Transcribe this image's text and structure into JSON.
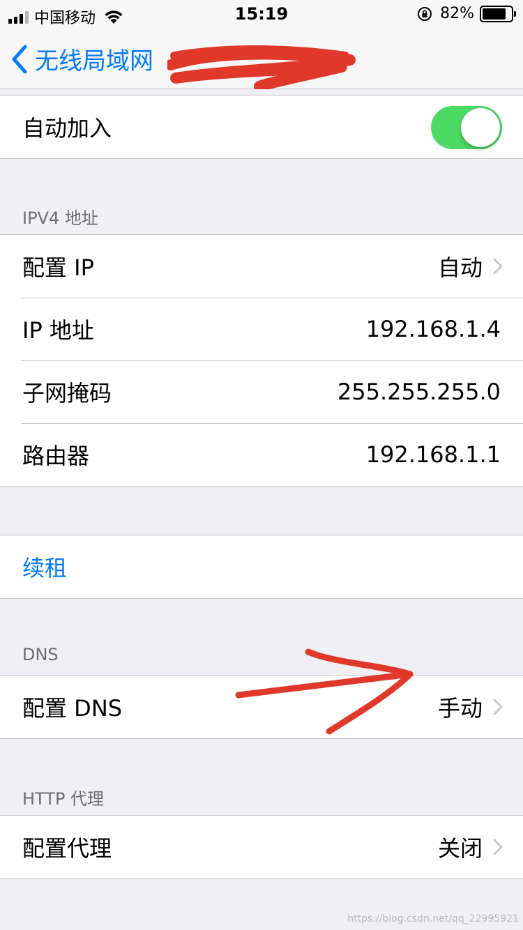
{
  "status_bar": {
    "carrier": "中国移动",
    "time": "15:19",
    "battery_percent": "82%",
    "battery_level": 0.82
  },
  "nav": {
    "back_label": "无线局域网"
  },
  "auto_join": {
    "label": "自动加入",
    "enabled": true,
    "toggle_color": "#4cd964"
  },
  "ipv4": {
    "header": "IPV4 地址",
    "rows": [
      {
        "label": "配置 IP",
        "value": "自动"
      },
      {
        "label": "IP 地址",
        "value": "192.168.1.4"
      },
      {
        "label": "子网掩码",
        "value": "255.255.255.0"
      },
      {
        "label": "路由器",
        "value": "192.168.1.1"
      }
    ]
  },
  "renew": {
    "label": "续租",
    "color": "#007aff"
  },
  "dns": {
    "header": "DNS",
    "row": {
      "label": "配置 DNS",
      "value": "手动"
    }
  },
  "http_proxy": {
    "header": "HTTP 代理",
    "row": {
      "label": "配置代理",
      "value": "关闭"
    }
  },
  "watermark": "https://blog.csdn.net/qq_22995921",
  "icons": [
    "signal-icon",
    "wifi-icon",
    "rotation-lock-icon",
    "battery-icon",
    "back-chevron-icon",
    "chevron-right-icon"
  ],
  "colors": {
    "accent": "#007aff",
    "background": "#efeff4",
    "annotation": "#e0392b"
  }
}
